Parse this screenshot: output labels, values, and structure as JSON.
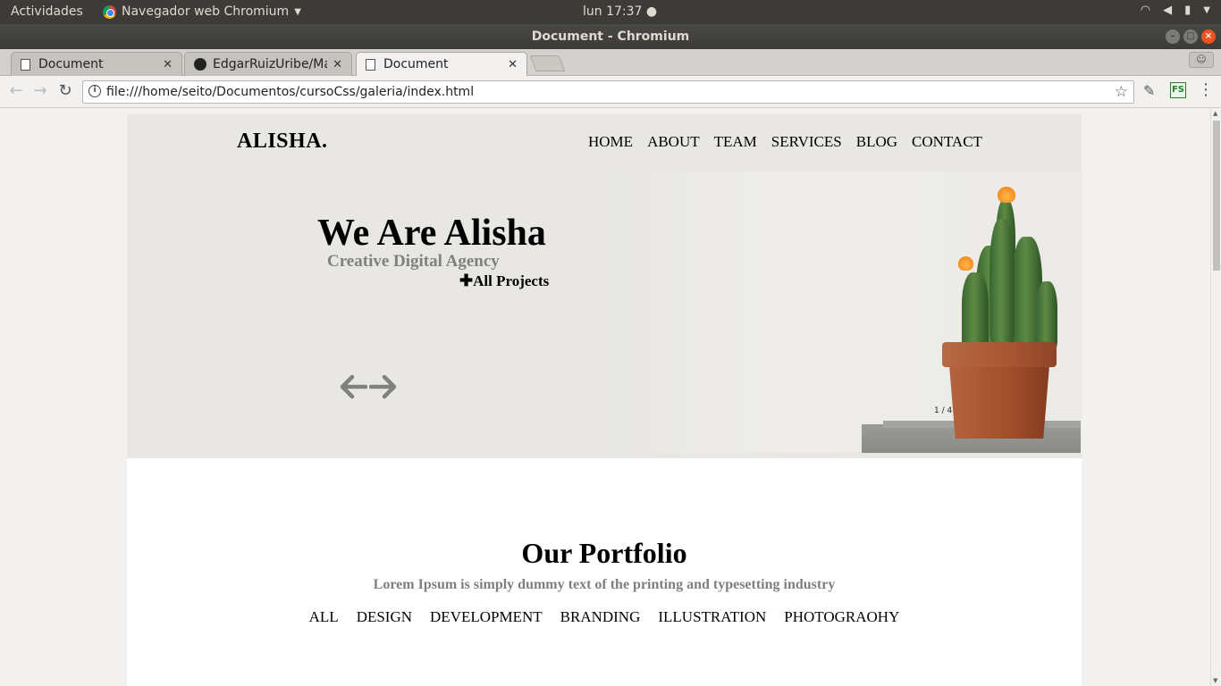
{
  "os": {
    "activities": "Actividades",
    "app_name": "Navegador web Chromium",
    "clock": "lun 17:37 ●"
  },
  "window": {
    "title": "Document - Chromium"
  },
  "tabs": [
    {
      "label": "Document",
      "icon": "page-icon",
      "active": false
    },
    {
      "label": "EdgarRuizUribe/Ma",
      "icon": "github-icon",
      "active": false
    },
    {
      "label": "Document",
      "icon": "page-icon",
      "active": true
    }
  ],
  "address_bar": {
    "url": "file:///home/seito/Documentos/cursoCss/galeria/index.html"
  },
  "extensions": {
    "fs_label": "FS"
  },
  "page": {
    "brand": "ALISHA.",
    "nav": [
      "HOME",
      "ABOUT",
      "TEAM",
      "SERVICES",
      "BLOG",
      "CONTACT"
    ],
    "hero": {
      "title": "We Are Alisha",
      "subtitle": "Creative Digital Agency",
      "link": "All Projects",
      "slide_counter": "1 / 4"
    },
    "portfolio": {
      "title": "Our Portfolio",
      "subtitle": "Lorem Ipsum is simply dummy text of the printing and typesetting industry",
      "filters": [
        "ALL",
        "DESIGN",
        "DEVELOPMENT",
        "BRANDING",
        "ILLUSTRATION",
        "PHOTOGRAOHY"
      ]
    }
  },
  "colors": {
    "hero_bg": "#e8e7e3",
    "subtitle_gray": "#808080",
    "ubuntu_orange": "#e95420"
  }
}
